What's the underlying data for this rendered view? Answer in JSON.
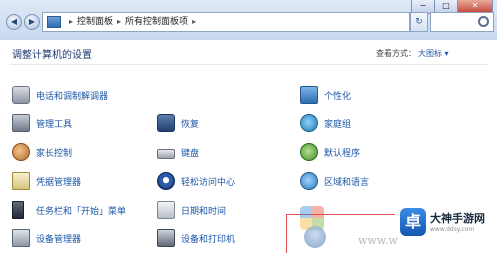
{
  "window": {
    "min": "−",
    "max": "□",
    "close": "✕"
  },
  "address": {
    "crumbs": [
      "控制面板",
      "所有控制面板项"
    ]
  },
  "header": {
    "title": "调整计算机的设置",
    "view_by_label": "查看方式：",
    "view_by_value": "大图标 ▾"
  },
  "items": {
    "col1": [
      "电话和调制解调器",
      "管理工具",
      "家长控制",
      "凭据管理器",
      "任务栏和「开始」菜单",
      "设备管理器"
    ],
    "col2": [
      "恢复",
      "键盘",
      "轻松访问中心",
      "日期和时间",
      "设备和打印机"
    ],
    "col3": [
      "个性化",
      "家庭组",
      "默认程序",
      "区域和语言"
    ]
  },
  "watermark": {
    "brand": "大神手游网",
    "url": "www.ddsy.com",
    "logo_char": "卓",
    "www": "www.w"
  }
}
